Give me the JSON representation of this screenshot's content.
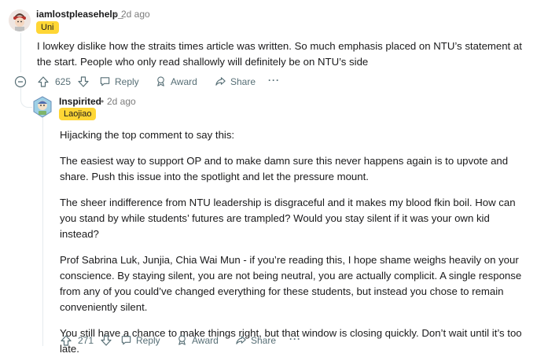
{
  "top_comment": {
    "username": "iamlostpleasehelp_",
    "time": "2d ago",
    "flair": "Uni",
    "text": "I lowkey dislike how the straits times article was written. So much emphasis placed on NTU’s statement at the start. People who only read shallowly will definitely be on NTU’s side",
    "votes": "625",
    "reply_label": "Reply",
    "award_label": "Award",
    "share_label": "Share",
    "more_label": "···"
  },
  "reply_comment": {
    "username": "Inspirited",
    "time": "2d ago",
    "flair": "Laojiao",
    "paragraphs": [
      "Hijacking the top comment to say this:",
      "The easiest way to support OP and to make damn sure this never happens again is to upvote and share. Push this issue into the spotlight and let the pressure mount.",
      "The sheer indifference from NTU leadership is disgraceful and it makes my blood fkin boil. How can you stand by while students’ futures are trampled? Would you stay silent if it was your own kid instead?",
      "Prof Sabrina Luk, Junjia, Chia Wai Mun - if you’re reading this, I hope shame weighs heavily on your conscience. By staying silent, you are not being neutral, you are actually complicit. A single response from any of you could’ve changed everything for these students, but instead you chose to remain conveniently silent.",
      "You still have a chance to make things right, but that window is closing quickly. Don’t wait until it’s too late."
    ],
    "votes": "271",
    "reply_label": "Reply",
    "award_label": "Award",
    "share_label": "Share",
    "more_label": "···"
  },
  "colors": {
    "flair_bg": "#ffd635",
    "thread_line": "#e5ebee",
    "action_text": "#576f76"
  },
  "icons": [
    "avatar",
    "collapse-minus-icon",
    "upvote-icon",
    "downvote-icon",
    "reply-bubble-icon",
    "award-icon",
    "share-icon",
    "more-icon"
  ]
}
